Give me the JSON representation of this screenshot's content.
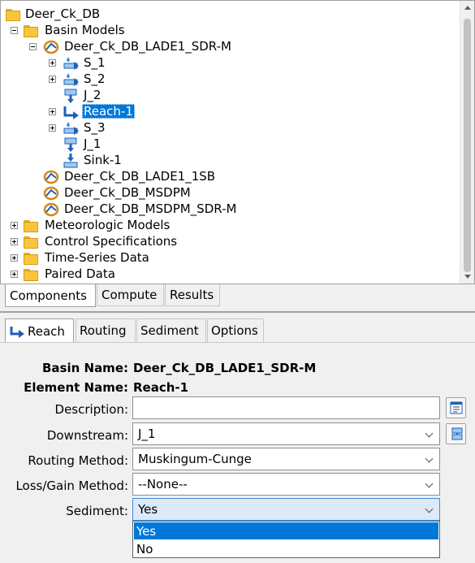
{
  "tree": {
    "root": "Deer_Ck_DB",
    "basin_models_folder": "Basin Models",
    "basin_selected": "Deer_Ck_DB_LADE1_SDR-M",
    "elements": [
      "S_1",
      "S_2",
      "J_2",
      "Reach-1",
      "S_3",
      "J_1",
      "Sink-1"
    ],
    "other_basins": [
      "Deer_Ck_DB_LADE1_1SB",
      "Deer_Ck_DB_MSDPM",
      "Deer_Ck_DB_MSDPM_SDR-M"
    ],
    "folders": [
      "Meteorologic Models",
      "Control Specifications",
      "Time-Series Data",
      "Paired Data"
    ]
  },
  "main_tabs": [
    "Components",
    "Compute",
    "Results"
  ],
  "editor_tabs": [
    "Reach",
    "Routing",
    "Sediment",
    "Options"
  ],
  "editor": {
    "basin_name_label": "Basin Name:",
    "basin_name_value": "Deer_Ck_DB_LADE1_SDR-M",
    "element_name_label": "Element Name:",
    "element_name_value": "Reach-1",
    "description_label": "Description:",
    "description_value": "",
    "downstream_label": "Downstream:",
    "downstream_value": "J_1",
    "routing_label": "Routing Method:",
    "routing_value": "Muskingum-Cunge",
    "lossgain_label": "Loss/Gain Method:",
    "lossgain_value": "--None--",
    "sediment_label": "Sediment:",
    "sediment_value": "Yes",
    "sediment_options": [
      "Yes",
      "No"
    ]
  },
  "colors": {
    "selection": "#0078d7",
    "folder": "#f8c63b",
    "basin_ring": "#d08a18",
    "element_blue": "#1f5fb8"
  }
}
